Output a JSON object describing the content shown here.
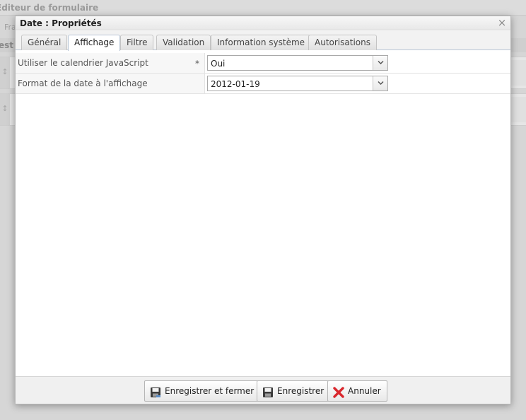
{
  "background": {
    "window_title": "Éditeur de formulaire",
    "toolbar_text": "Fra",
    "strip_text": "est",
    "row_handle": "↕"
  },
  "dialog": {
    "title": "Date : Propriétés",
    "close_label": "×"
  },
  "tabs": [
    {
      "label": "Général"
    },
    {
      "label": "Affichage"
    },
    {
      "label": "Filtre"
    },
    {
      "label": "Validation"
    },
    {
      "label": "Information système"
    },
    {
      "label": "Autorisations"
    }
  ],
  "active_tab": "Affichage",
  "fields": [
    {
      "label": "Utiliser le calendrier JavaScript",
      "required_mark": "*",
      "value": "Oui"
    },
    {
      "label": "Format de la date à l'affichage",
      "required_mark": "",
      "value": "2012-01-19"
    }
  ],
  "buttons": {
    "save_close": "Enregistrer et fermer",
    "save": "Enregistrer",
    "cancel": "Annuler"
  },
  "icons": {
    "save_close": "floppy-disk-icon",
    "save": "floppy-disk-icon",
    "cancel": "red-x-icon",
    "dropdown": "chevron-down-icon"
  },
  "colors": {
    "cancel_icon": "#d9262c",
    "tab_border": "#b9c6d6"
  }
}
